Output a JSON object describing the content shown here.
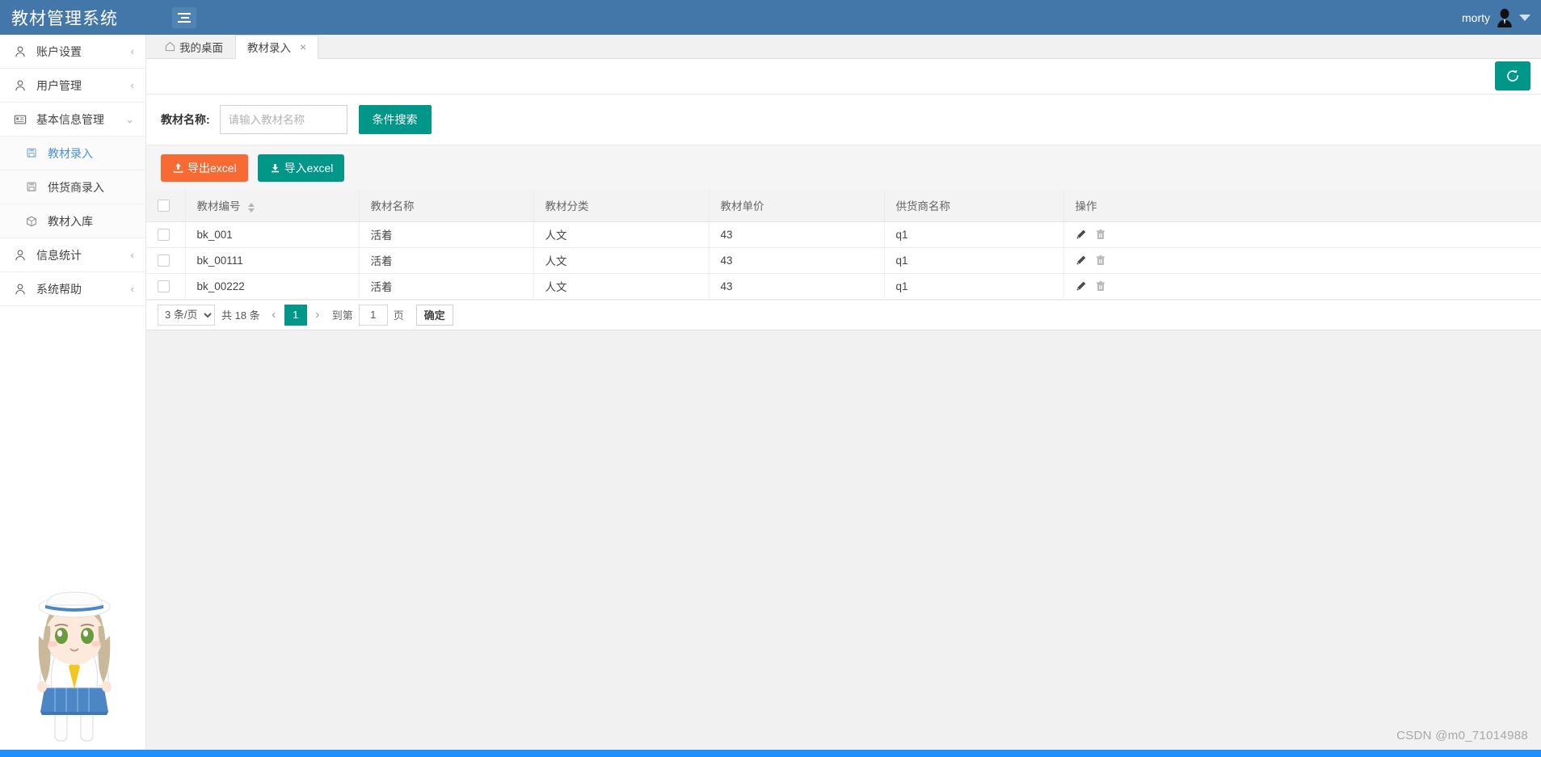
{
  "header": {
    "brand": "教材管理系统",
    "menu_toggle_icon": "hamburger-icon",
    "username": "morty",
    "avatar_icon": "user-avatar-icon",
    "caret_icon": "chevron-down-icon"
  },
  "sidebar": {
    "items": [
      {
        "label": "账户设置",
        "icon": "user-icon",
        "arrow": "‹",
        "level": 0,
        "active": false
      },
      {
        "label": "用户管理",
        "icon": "user-icon",
        "arrow": "‹",
        "level": 0,
        "active": false
      },
      {
        "label": "基本信息管理",
        "icon": "id-card-icon",
        "arrow": "⌄",
        "level": 0,
        "active": false
      },
      {
        "label": "教材录入",
        "icon": "file-save-icon",
        "arrow": "",
        "level": 1,
        "active": true
      },
      {
        "label": "供货商录入",
        "icon": "file-save-icon",
        "arrow": "",
        "level": 1,
        "active": false
      },
      {
        "label": "教材入库",
        "icon": "box-icon",
        "arrow": "",
        "level": 1,
        "active": false
      },
      {
        "label": "信息统计",
        "icon": "user-icon",
        "arrow": "‹",
        "level": 0,
        "active": false
      },
      {
        "label": "系统帮助",
        "icon": "user-icon",
        "arrow": "‹",
        "level": 0,
        "active": false
      }
    ],
    "mascot_alt": "anime-sailor-mascot"
  },
  "tabs": [
    {
      "label": "我的桌面",
      "icon": "home-icon",
      "active": false,
      "closable": false
    },
    {
      "label": "教材录入",
      "icon": "",
      "active": true,
      "closable": true,
      "close_glyph": "×"
    }
  ],
  "toolbar_top": {
    "refresh_icon": "refresh-icon",
    "refresh_color": "#009688"
  },
  "search": {
    "label": "教材名称:",
    "value": "",
    "placeholder": "请输入教材名称",
    "button_label": "条件搜索",
    "button_color": "#009688"
  },
  "actions": {
    "export_label": "导出excel",
    "export_icon": "upload-icon",
    "export_color": "#f86a33",
    "import_label": "导入excel",
    "import_icon": "download-icon",
    "import_color": "#009688"
  },
  "table": {
    "select_all_checked": false,
    "columns": [
      {
        "key": "check",
        "label": "",
        "sortable": false
      },
      {
        "key": "code",
        "label": "教材编号",
        "sortable": true
      },
      {
        "key": "name",
        "label": "教材名称",
        "sortable": false
      },
      {
        "key": "category",
        "label": "教材分类",
        "sortable": false
      },
      {
        "key": "price",
        "label": "教材单价",
        "sortable": false
      },
      {
        "key": "supplier",
        "label": "供货商名称",
        "sortable": false
      },
      {
        "key": "ops",
        "label": "操作",
        "sortable": false
      }
    ],
    "rows": [
      {
        "code": "bk_001",
        "name": "活着",
        "category": "人文",
        "price": "43",
        "supplier": "q1",
        "edit_icon": "pencil-icon",
        "delete_icon": "trash-icon"
      },
      {
        "code": "bk_00111",
        "name": "活着",
        "category": "人文",
        "price": "43",
        "supplier": "q1",
        "edit_icon": "pencil-icon",
        "delete_icon": "trash-icon"
      },
      {
        "code": "bk_00222",
        "name": "活着",
        "category": "人文",
        "price": "43",
        "supplier": "q1",
        "edit_icon": "pencil-icon",
        "delete_icon": "trash-icon"
      }
    ]
  },
  "pagination": {
    "page_size_label": "3 条/页",
    "page_size_options": [
      "3 条/页"
    ],
    "total_label": "共 18 条",
    "prev_glyph": "‹",
    "next_glyph": "›",
    "current_page": "1",
    "goto_prefix": "到第",
    "goto_value": "1",
    "goto_suffix": "页",
    "confirm_label": "确定",
    "active_color": "#009688"
  },
  "footer": {
    "watermark": "CSDN @m0_71014988",
    "bar_color": "#1e90ff"
  }
}
